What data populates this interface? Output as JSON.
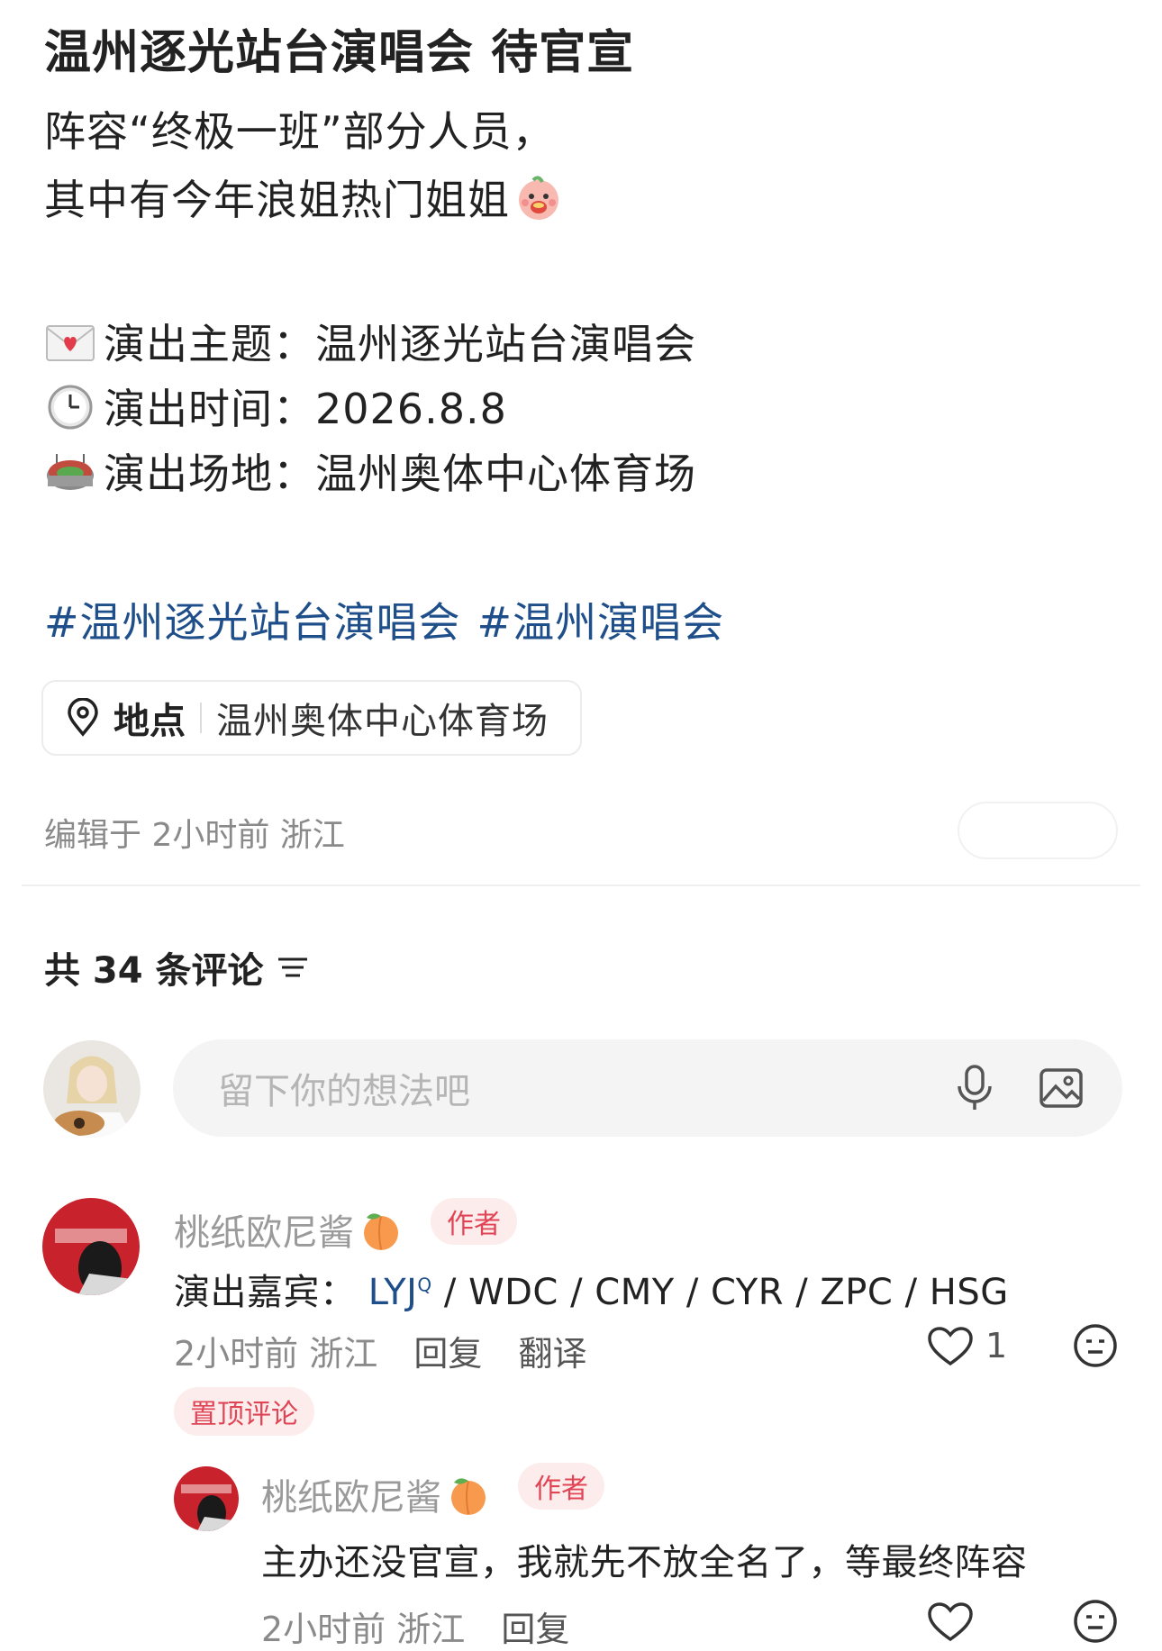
{
  "post": {
    "title": "温州逐光站台演唱会 待官宣",
    "line1": "阵容“终极一班”部分人员，",
    "line2": "其中有今年浪姐热门姐姐",
    "info": [
      {
        "icon": "love-letter-icon",
        "label": "演出主题：",
        "value": "温州逐光站台演唱会"
      },
      {
        "icon": "clock-icon",
        "label": "演出时间：",
        "value": "2026.8.8"
      },
      {
        "icon": "stadium-icon",
        "label": "演出场地：",
        "value": "温州奥体中心体育场"
      }
    ],
    "tags": [
      "#温州逐光站台演唱会",
      "#温州演唱会"
    ],
    "location_label": "地点",
    "location_value": "温州奥体中心体育场",
    "edited": "编辑于 2小时前 浙江"
  },
  "comments_header": {
    "count_text": "共 34 条评论"
  },
  "input": {
    "placeholder": "留下你的想法吧"
  },
  "comments": [
    {
      "user": "桃纸欧尼酱",
      "badge": "作者",
      "text_prefix": "演出嘉宾：",
      "mention": "LYJ",
      "text_suffix": " / WDC / CMY / CYR / ZPC / HSG",
      "time_loc": "2小时前 浙江",
      "reply": "回复",
      "translate": "翻译",
      "likes": "1",
      "pinned": "置顶评论"
    },
    {
      "user": "桃纸欧尼酱",
      "badge": "作者",
      "text": "主办还没官宣，我就先不放全名了，等最终阵容",
      "time_loc": "2小时前 浙江",
      "reply": "回复"
    }
  ],
  "colors": {
    "tag_blue": "#1f4f8a",
    "badge_red": "#e04556",
    "badge_bg": "#fdecec"
  }
}
